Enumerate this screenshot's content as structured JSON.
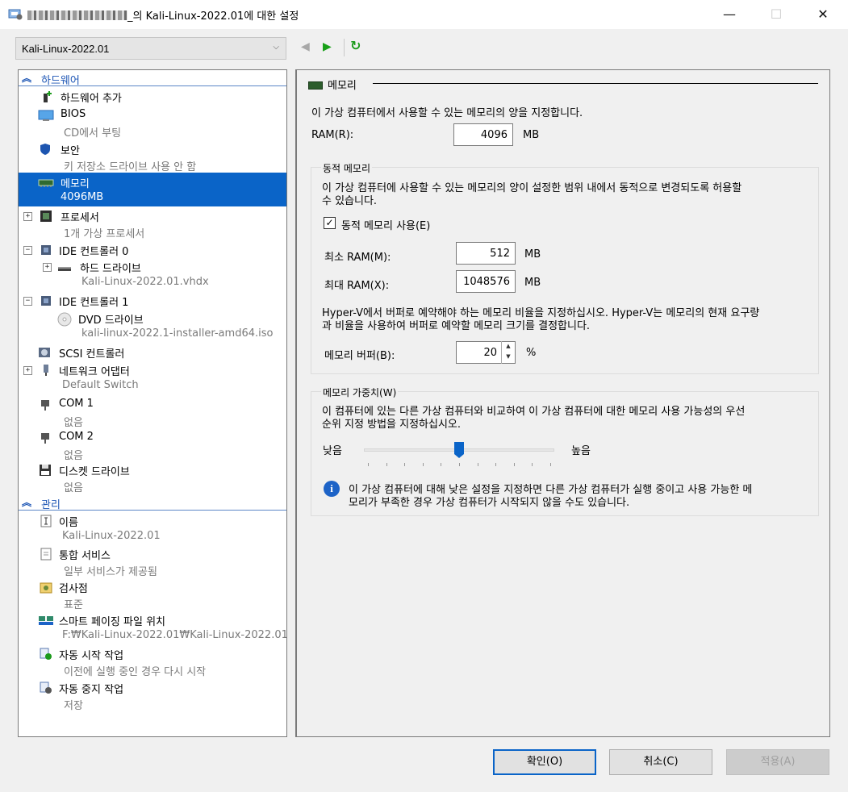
{
  "window": {
    "title_suffix": "_의 Kali-Linux-2022.01에 대한 설정",
    "min_glyph": "—",
    "max_glyph": "☐",
    "close_glyph": "✕"
  },
  "vm_selector": {
    "value": "Kali-Linux-2022.01"
  },
  "tree": {
    "hardware_label": "하드웨어",
    "management_label": "관리",
    "items": [
      {
        "name": "하드웨어 추가",
        "sub": "",
        "icon": "add-hardware-icon"
      },
      {
        "name": "BIOS",
        "sub": "CD에서 부팅",
        "icon": "bios-icon"
      },
      {
        "name": "보안",
        "sub": "키 저장소 드라이브 사용 안 함",
        "icon": "shield-icon"
      },
      {
        "name": "메모리",
        "sub": "4096MB",
        "icon": "memory-icon"
      },
      {
        "name": "프로세서",
        "sub": "1개 가상 프로세서",
        "icon": "processor-icon"
      },
      {
        "name": "IDE 컨트롤러 0",
        "sub": "",
        "icon": "ide-controller-icon"
      },
      {
        "name": "하드 드라이브",
        "sub": "Kali-Linux-2022.01.vhdx",
        "icon": "hard-drive-icon"
      },
      {
        "name": "IDE 컨트롤러 1",
        "sub": "",
        "icon": "ide-controller-icon"
      },
      {
        "name": "DVD 드라이브",
        "sub": "kali-linux-2022.1-installer-amd64.iso",
        "icon": "dvd-icon"
      },
      {
        "name": "SCSI 컨트롤러",
        "sub": "",
        "icon": "scsi-icon"
      },
      {
        "name": "네트워크 어댑터",
        "sub": "Default Switch",
        "icon": "network-adapter-icon"
      },
      {
        "name": "COM 1",
        "sub": "없음",
        "icon": "com-port-icon"
      },
      {
        "name": "COM 2",
        "sub": "없음",
        "icon": "com-port-icon"
      },
      {
        "name": "디스켓 드라이브",
        "sub": "없음",
        "icon": "floppy-icon"
      },
      {
        "name": "이름",
        "sub": "Kali-Linux-2022.01",
        "icon": "name-icon"
      },
      {
        "name": "통합 서비스",
        "sub": "일부 서비스가 제공됨",
        "icon": "integration-services-icon"
      },
      {
        "name": "검사점",
        "sub": "표준",
        "icon": "checkpoint-icon"
      },
      {
        "name": "스마트 페이징 파일 위치",
        "sub": "F:₩Kali-Linux-2022.01₩Kali-Linux-2022.01",
        "icon": "smart-paging-icon"
      },
      {
        "name": "자동 시작 작업",
        "sub": "이전에 실행 중인 경우 다시 시작",
        "icon": "auto-start-icon"
      },
      {
        "name": "자동 중지 작업",
        "sub": "저장",
        "icon": "auto-stop-icon"
      }
    ],
    "expander_plus": "+",
    "expander_minus": "−"
  },
  "memory": {
    "header": "메모리",
    "description": "이 가상 컴퓨터에서 사용할 수 있는 메모리의 양을 지정합니다.",
    "ram_label": "RAM(R):",
    "ram_value": "4096",
    "unit_mb": "MB",
    "dynamic": {
      "legend": "동적 메모리",
      "desc_line1": "이 가상 컴퓨터에 사용할 수 있는 메모리의 양이 설정한 범위 내에서 동적으로 변경되도록 허용할",
      "desc_line2": "수 있습니다.",
      "enable_label": "동적 메모리 사용(E)",
      "enable_checked": true,
      "check_glyph": "✓",
      "min_label": "최소 RAM(M):",
      "min_value": "512",
      "max_label": "최대 RAM(X):",
      "max_value": "1048576",
      "buffer_desc_line1": "Hyper-V에서 버퍼로 예약해야 하는 메모리 비율을 지정하십시오. Hyper-V는 메모리의 현재 요구량",
      "buffer_desc_line2": "과 비율을 사용하여 버퍼로 예약할 메모리 크기를 결정합니다.",
      "buffer_label": "메모리 버퍼(B):",
      "buffer_value": "20",
      "buffer_unit": "%"
    },
    "weight": {
      "legend": "메모리 가중치(W)",
      "desc_line1": "이 컴퓨터에 있는 다른 가상 컴퓨터와 비교하여 이 가상 컴퓨터에 대한 메모리 사용 가능성의 우선",
      "desc_line2": "순위 지정 방법을 지정하십시오.",
      "low_label": "낮음",
      "high_label": "높음",
      "slider_level": 0.5,
      "info_line1": "이 가상 컴퓨터에 대해 낮은 설정을 지정하면 다른 가상 컴퓨터가 실행 중이고 사용 가능한 메",
      "info_line2": "모리가 부족한 경우 가상 컴퓨터가 시작되지 않을 수도 있습니다.",
      "info_glyph": "i"
    }
  },
  "buttons": {
    "ok": "확인(O)",
    "cancel": "취소(C)",
    "apply": "적용(A)"
  },
  "colors": {
    "accent": "#0a64c8",
    "section": "#1e56b5"
  }
}
